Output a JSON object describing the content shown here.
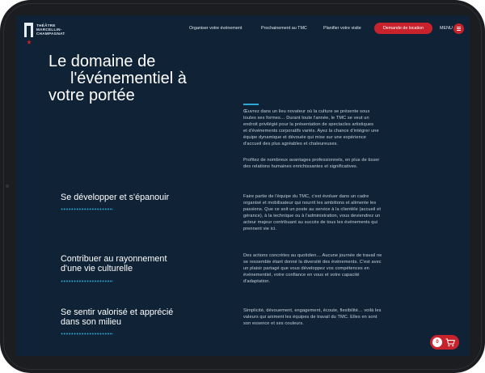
{
  "header": {
    "logo_text": "THÉÂTRE\nMARCELLIN-\nCHAMPAGNAT",
    "nav": [
      {
        "label": "Organiser votre événement"
      },
      {
        "label": "Prochainement au TMC"
      },
      {
        "label": "Planifier votre visite"
      }
    ],
    "cta_label": "Demande de location",
    "menu_label": "MENU"
  },
  "hero": {
    "title_lines": [
      "Le domaine de",
      "l'événementiel à",
      "votre portée"
    ],
    "intro_lines": [
      "Œuvrez dans un lieu novateur où la culture se présente sous",
      "toutes ses formes… Durant toute l'année, le TMC se veut un",
      "endroit privilégié pour la présentation de spectacles artistiques",
      "et d'événements corporatifs variés. Ayez la chance d'intégrer une",
      "équipe dynamique et dévouée qui mise sur une expérience",
      "d'accueil des plus agréables et chaleureuses."
    ],
    "intro2_lines": [
      "Profitez de nombreux avantages professionnels, en plus de tisser",
      "des relations humaines enrichissantes et significatives."
    ]
  },
  "sections": [
    {
      "title_lines": [
        "Se développer et s'épanouir"
      ],
      "text_lines": [
        "Faire partie de l'équipe du TMC, c'est évoluer dans un cadre",
        "organisé et mobilisateur qui nourrit les ambitions et alimente les",
        "passions. Que ce soit un poste au service à la clientèle (accueil et",
        "gérance), à la technique ou à l'administration, vous deviendrez un",
        "acteur majeur contribuant au succès de tous les événements qui",
        "prennent vie ici."
      ]
    },
    {
      "title_lines": [
        "Contribuer au rayonnement",
        "d'une vie culturelle"
      ],
      "text_lines": [
        "Des actions concrètes au quotidien… Aucune journée de travail ne",
        "se ressemble étant donné la diversité des événements. C'est avec",
        "un plaisir partagé que vous développez vos compétences en",
        "événementiel, votre confiance en vous et votre capacité",
        "d'adaptation."
      ]
    },
    {
      "title_lines": [
        "Se sentir valorisé et apprécié",
        "dans son milieu"
      ],
      "text_lines": [
        "Simplicité, dévouement, engagement, écoute, flexibilité… voilà les",
        "valeurs qui animent les équipes de travail du TMC. Elles en sont",
        "son essence et ses couleurs."
      ]
    }
  ],
  "cart": {
    "count": "0",
    "icon": "shopping-cart-icon"
  },
  "colors": {
    "background": "#0f2236",
    "accent": "#c8222c",
    "dots": "#2fa7d6",
    "device": "#1b1d20"
  }
}
